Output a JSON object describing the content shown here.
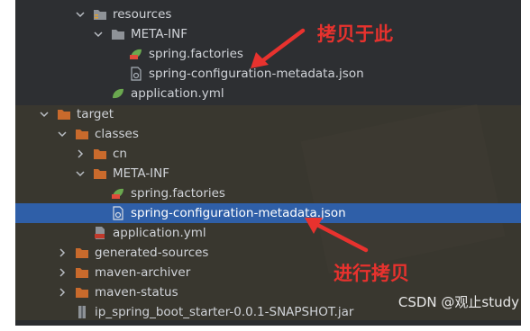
{
  "tree": {
    "rows": [
      {
        "label": "resources",
        "icon": "folder-resources-icon",
        "chevron": "down"
      },
      {
        "label": "META-INF",
        "icon": "folder-icon",
        "chevron": "down"
      },
      {
        "label": "spring.factories",
        "icon": "spring-leaf-icon",
        "chevron": ""
      },
      {
        "label": "spring-configuration-metadata.json",
        "icon": "json-config-file-icon",
        "chevron": ""
      },
      {
        "label": "application.yml",
        "icon": "spring-leaf-icon",
        "chevron": ""
      },
      {
        "label": "target",
        "icon": "folder-orange-icon",
        "chevron": "down"
      },
      {
        "label": "classes",
        "icon": "folder-orange-icon",
        "chevron": "down"
      },
      {
        "label": "cn",
        "icon": "folder-orange-icon",
        "chevron": "right"
      },
      {
        "label": "META-INF",
        "icon": "folder-orange-icon",
        "chevron": "down"
      },
      {
        "label": "spring.factories",
        "icon": "spring-leaf-icon",
        "chevron": ""
      },
      {
        "label": "spring-configuration-metadata.json",
        "icon": "json-config-file-icon",
        "chevron": "",
        "selected": true
      },
      {
        "label": "application.yml",
        "icon": "yml-file-icon",
        "chevron": ""
      },
      {
        "label": "generated-sources",
        "icon": "folder-orange-icon",
        "chevron": "right"
      },
      {
        "label": "maven-archiver",
        "icon": "folder-orange-icon",
        "chevron": "right"
      },
      {
        "label": "maven-status",
        "icon": "folder-orange-icon",
        "chevron": "right"
      },
      {
        "label": "ip_spring_boot_starter-0.0.1-SNAPSHOT.jar",
        "icon": "jar-file-icon",
        "chevron": ""
      }
    ]
  },
  "annotations": {
    "copy_here": "拷贝于此",
    "do_copy": "进行拷贝"
  },
  "watermark": "CSDN @观止study",
  "colors": {
    "annotation_red": "#e8322e",
    "selection_blue": "#2f5fa8",
    "folder_orange": "#c96a2c",
    "spring_green": "#6aa84f"
  }
}
